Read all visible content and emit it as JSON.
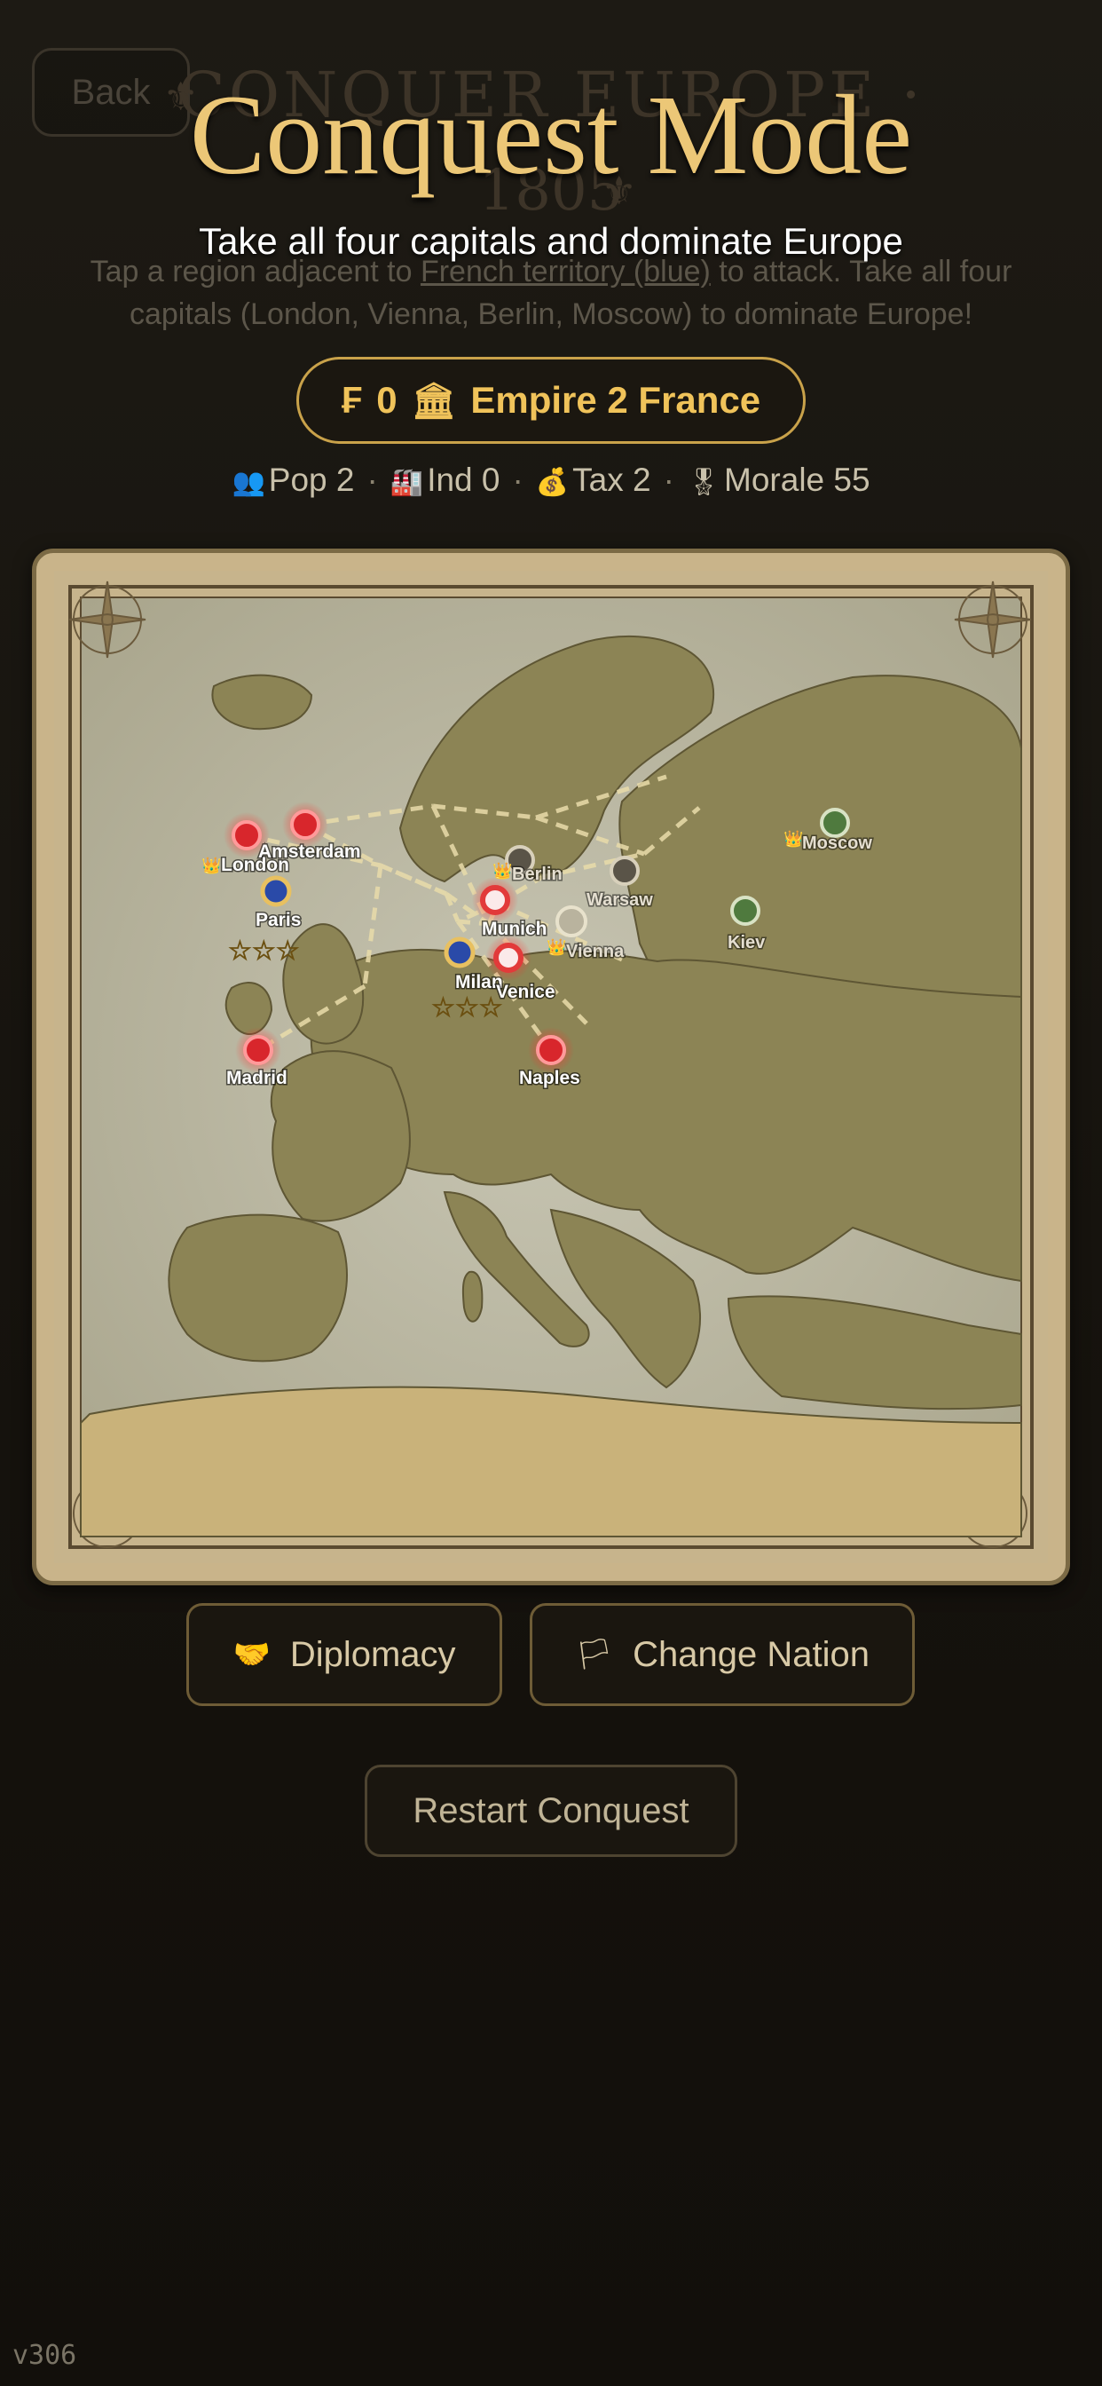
{
  "header": {
    "back_label": "Back",
    "ghost_title": "CONQUER EUROPE ·",
    "ghost_year": "1805",
    "title": "Conquest Mode",
    "subtitle": "Take all four capitals and dominate Europe",
    "instructions_pre": "Tap a region adjacent to ",
    "instructions_link": "French territory (blue)",
    "instructions_post": " to attack. Take all four capitals (London, Vienna, Berlin, Moscow) to dominate Europe!"
  },
  "treasury": {
    "currency_symbol": "₣",
    "amount": "0",
    "label": "Empire 2 France"
  },
  "stats": {
    "pop": "Pop 2",
    "ind": "Ind 0",
    "tax": "Tax 2",
    "morale": "Morale 55"
  },
  "map": {
    "cities": {
      "london": "London",
      "amsterdam": "Amsterdam",
      "berlin": "Berlin",
      "warsaw": "Warsaw",
      "moscow": "Moscow",
      "kiev": "Kiev",
      "paris": "Paris",
      "munich": "Munich",
      "vienna": "Vienna",
      "milan": "Milan",
      "venice": "Venice",
      "madrid": "Madrid",
      "naples": "Naples"
    },
    "paris_stars": "☆☆☆",
    "milan_stars": "☆☆☆",
    "colors": {
      "french": "#2a4aa8",
      "enemy": "#d8262c",
      "neutral": "#5a5448",
      "russian": "#4f7a3e"
    }
  },
  "actions": {
    "diplomacy_label": "Diplomacy",
    "change_nation_label": "Change Nation",
    "restart_label": "Restart Conquest"
  },
  "footer": {
    "version": "v306"
  }
}
